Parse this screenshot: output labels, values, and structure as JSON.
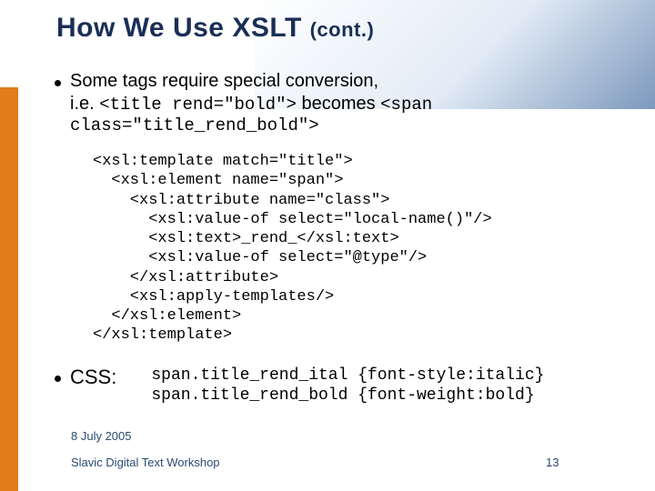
{
  "title": {
    "main": "How We Use XSLT ",
    "cont": "(cont.)"
  },
  "bullet1": {
    "line": "Some tags require special conversion,",
    "sub_pre": "i.e. ",
    "code1": "<title rend=\"bold\">",
    "sub_mid": " becomes ",
    "code2": "<span class=\"title_rend_bold\">"
  },
  "codeblock": "<xsl:template match=\"title\">\n  <xsl:element name=\"span\">\n    <xsl:attribute name=\"class\">\n      <xsl:value-of select=\"local-name()\"/>\n      <xsl:text>_rend_</xsl:text>\n      <xsl:value-of select=\"@type\"/>\n    </xsl:attribute>\n    <xsl:apply-templates/>\n  </xsl:element>\n</xsl:template>",
  "bullet2": {
    "label": "CSS:",
    "block": "span.title_rend_ital {font-style:italic}\nspan.title_rend_bold {font-weight:bold}"
  },
  "footer": {
    "date": "8 July 2005",
    "source": "Slavic Digital Text Workshop",
    "page": "13"
  }
}
